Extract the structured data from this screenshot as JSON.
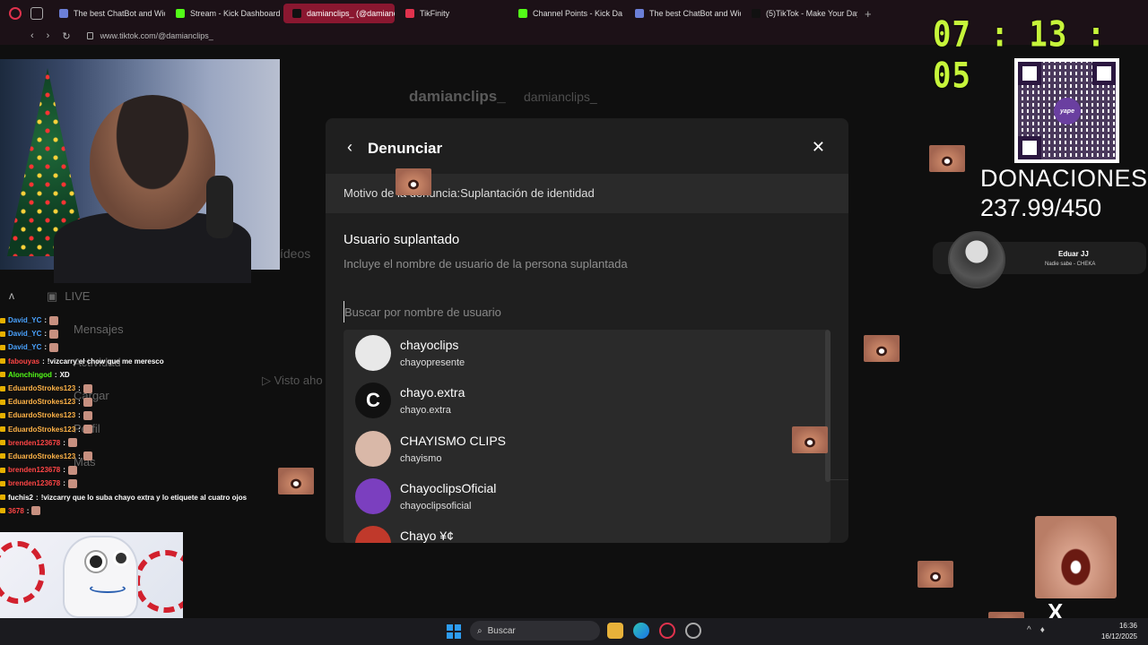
{
  "browser": {
    "tabs": [
      {
        "label": "The best ChatBot and Wid",
        "fav": "#6b7fd7"
      },
      {
        "label": "Stream - Kick Dashboard",
        "fav": "#53fc18"
      },
      {
        "label": "damianclips_ (@damiancl",
        "fav": "#111111",
        "active": true
      },
      {
        "label": "TikFinity",
        "fav": "#e0324d"
      },
      {
        "label": "Channel Points - Kick Da",
        "fav": "#53fc18"
      },
      {
        "label": "The best ChatBot and Wid",
        "fav": "#6b7fd7"
      },
      {
        "label": "(5)TikTok - Make Your Day",
        "fav": "#111111"
      }
    ],
    "url": "www.tiktok.com/@damianclips_"
  },
  "timer": "07 : 13 : 05",
  "profile": {
    "name": "damianclips_",
    "handle": "damianclips_",
    "videos_label": "ídeos",
    "visto": "▷ Visto aho"
  },
  "sidenav": [
    "LIVE",
    "Mensajes",
    "Actividad",
    "Cargar",
    "Perfil",
    "Más"
  ],
  "chat": [
    {
      "user": "David_YC",
      "color": "#4aa3ff",
      "msg": ""
    },
    {
      "user": "David_YC",
      "color": "#4aa3ff",
      "msg": ""
    },
    {
      "user": "David_YC",
      "color": "#4aa3ff",
      "msg": ""
    },
    {
      "user": "fabouyas",
      "color": "#ff4545",
      "msg": "!vizcarry el chow que me meresco"
    },
    {
      "user": "Alonchingod",
      "color": "#53fc18",
      "msg": "XD"
    },
    {
      "user": "EduardoStrokes123",
      "color": "#ffb347",
      "msg": ""
    },
    {
      "user": "EduardoStrokes123",
      "color": "#ffb347",
      "msg": ""
    },
    {
      "user": "EduardoStrokes123",
      "color": "#ffb347",
      "msg": ""
    },
    {
      "user": "EduardoStrokes123",
      "color": "#ffb347",
      "msg": ""
    },
    {
      "user": "brenden123678",
      "color": "#ff4545",
      "msg": ""
    },
    {
      "user": "EduardoStrokes123",
      "color": "#ffb347",
      "msg": ""
    },
    {
      "user": "brenden123678",
      "color": "#ff4545",
      "msg": ""
    },
    {
      "user": "brenden123678",
      "color": "#ff4545",
      "msg": ""
    },
    {
      "user": "fuchis2",
      "color": "#ffffff",
      "msg": "!vizcarry que lo suba chayo extra y lo etiquete al cuatro ojos"
    },
    {
      "user": "3678",
      "color": "#ff4545",
      "msg": ""
    }
  ],
  "modal": {
    "back_icon": "‹",
    "title": "Denunciar",
    "close_icon": "✕",
    "reason": "Motivo de la denuncia:Suplantación de identidad",
    "section_title": "Usuario suplantado",
    "section_help": "Incluye el nombre de usuario de la persona suplantada",
    "search_placeholder": "Buscar por nombre de usuario",
    "search_value": "",
    "results": [
      {
        "name": "chayoclips",
        "handle": "chayopresente",
        "avatar": "#e8e8e8"
      },
      {
        "name": "chayo.extra",
        "handle": "chayo.extra",
        "avatar": "#111111"
      },
      {
        "name": "CHAYISMO CLIPS",
        "handle": "chayismo",
        "avatar": "#d9b8a8"
      },
      {
        "name": "ChayoclipsOficial",
        "handle": "chayoclipsoficial",
        "avatar": "#7b3fbf"
      },
      {
        "name": "Chayo ¥¢",
        "handle": "",
        "avatar": "#c0392b"
      }
    ]
  },
  "donations": {
    "title": "DONACIONES",
    "amount": "237.99/450",
    "qr_logo": "yape"
  },
  "song": {
    "title": "Eduar JJ",
    "subtitle": "Nadie sabe - CHEKA"
  },
  "taskbar": {
    "search": "Buscar",
    "time": "16:36",
    "date": "16/12/2025"
  }
}
